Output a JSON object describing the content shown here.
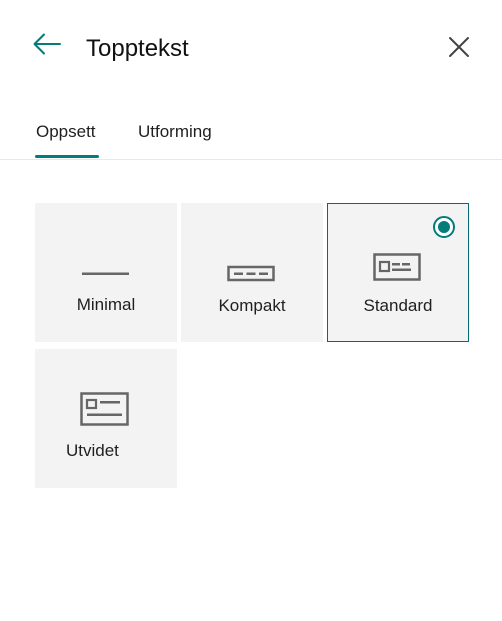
{
  "header": {
    "title": "Topptekst",
    "back_icon": "arrow-left-icon",
    "close_icon": "close-icon"
  },
  "tabs": [
    {
      "label": "Oppsett",
      "selected": true
    },
    {
      "label": "Utforming",
      "selected": false
    }
  ],
  "layouts": [
    {
      "label": "Minimal",
      "icon": "minimal-layout-icon",
      "selected": false
    },
    {
      "label": "Kompakt",
      "icon": "compact-layout-icon",
      "selected": false
    },
    {
      "label": "Standard",
      "icon": "standard-layout-icon",
      "selected": true
    },
    {
      "label": "Utvidet",
      "icon": "extended-layout-icon",
      "selected": false
    }
  ],
  "colors": {
    "accent": "#037c7c",
    "card_background": "#f3f3f3",
    "icon_gray": "#666666"
  }
}
